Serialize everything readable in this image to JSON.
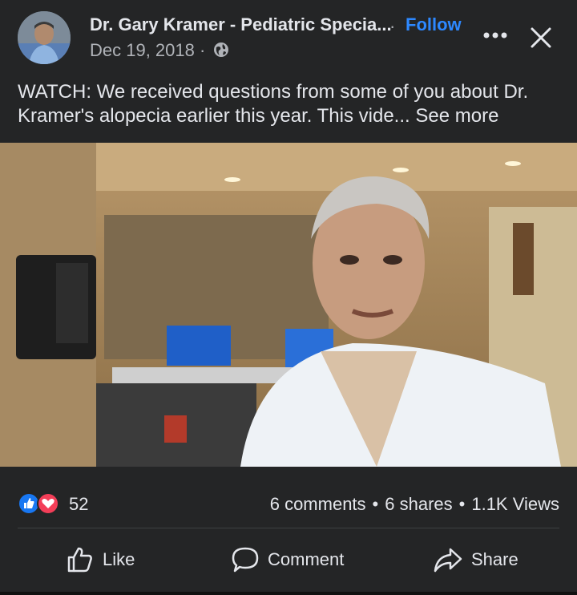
{
  "post": {
    "author": "Dr. Gary Kramer - Pediatric Specia...",
    "separator": "·",
    "follow_label": "Follow",
    "date": "Dec 19, 2018 ·",
    "caption_text": "WATCH: We received questions from some of you about Dr. Kramer's alopecia earlier this year. This vide... ",
    "see_more_label": "See more"
  },
  "stats": {
    "reaction_count": "52",
    "comments": "6 comments",
    "shares": "6 shares",
    "views": "1.1K Views",
    "separator": "•"
  },
  "actions": {
    "like_label": "Like",
    "comment_label": "Comment",
    "share_label": "Share"
  },
  "colors": {
    "background": "#242526",
    "accent": "#2d88ff",
    "like_reaction": "#1877f2",
    "love_reaction": "#f33e58"
  },
  "icons": {
    "privacy": "globe-icon",
    "menu": "more-dots-icon",
    "close": "close-icon",
    "like": "thumbs-up-icon",
    "comment": "comment-bubble-icon",
    "share": "share-arrow-icon"
  }
}
